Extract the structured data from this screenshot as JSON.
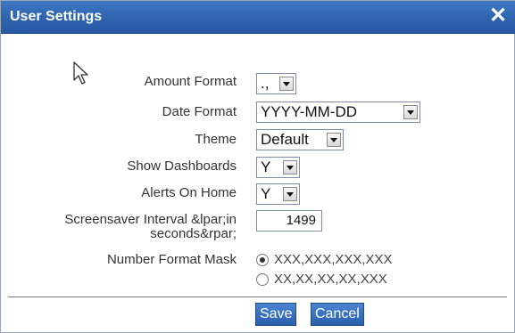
{
  "dialog": {
    "title": "User Settings",
    "close_glyph": "✕",
    "icons": {
      "close": "close-icon",
      "pointer": "mouse-pointer-icon",
      "dropdown": "chevron-down-icon"
    }
  },
  "fields": {
    "amount_format": {
      "label": "Amount Format",
      "value": "., "
    },
    "date_format": {
      "label": "Date Format",
      "value": "YYYY-MM-DD"
    },
    "theme": {
      "label": "Theme",
      "value": "Default"
    },
    "show_dashboards": {
      "label": "Show Dashboards",
      "value": "Y"
    },
    "alerts_on_home": {
      "label": "Alerts On Home",
      "value": "Y"
    },
    "screensaver_interval": {
      "label": "Screensaver Interval &lpar;in seconds&rpar;",
      "value": "1499"
    },
    "number_format_mask": {
      "label": "Number Format Mask",
      "options": [
        "XXX,XXX,XXX,XXX",
        "XX,XX,XX,XX,XXX"
      ],
      "selected_index": 0
    }
  },
  "buttons": {
    "save": "Save",
    "cancel": "Cancel"
  }
}
